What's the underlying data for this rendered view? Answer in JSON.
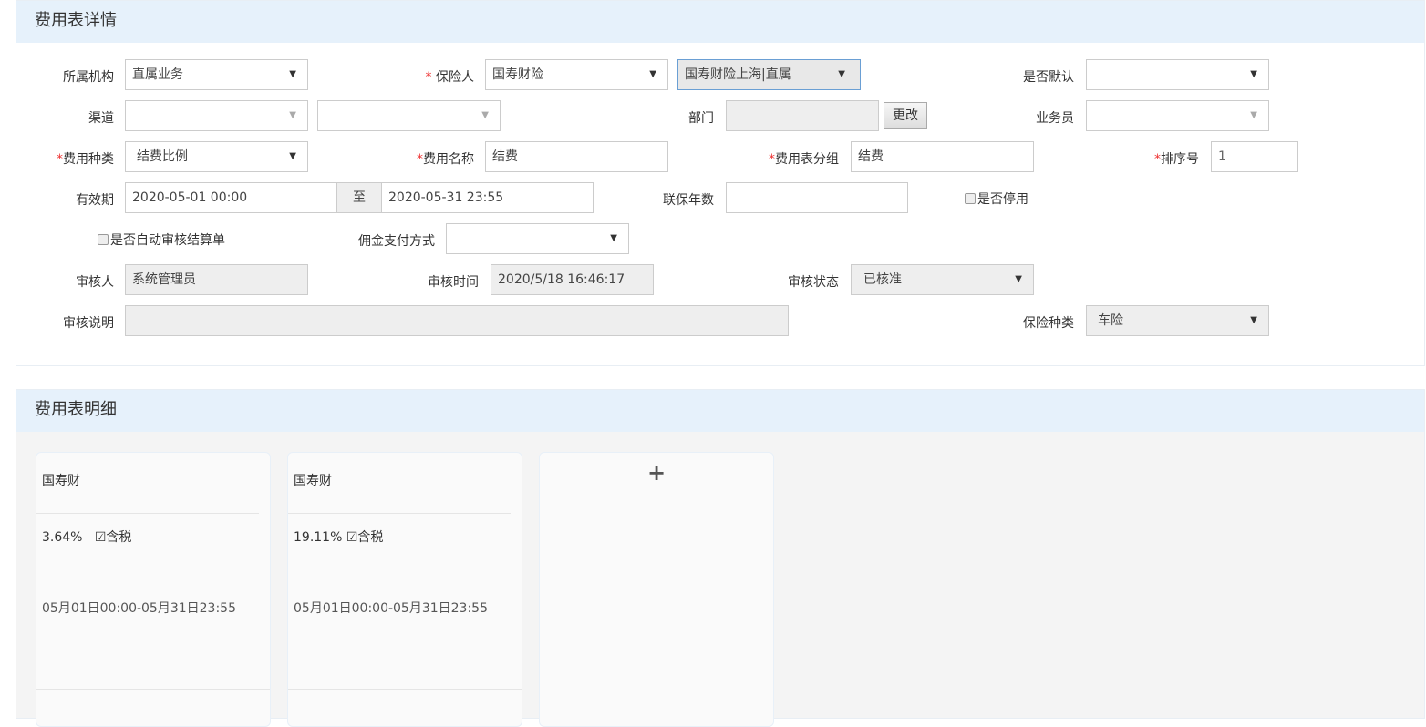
{
  "detail": {
    "title": "费用表详情",
    "org": {
      "label": "所属机构",
      "value": "直属业务"
    },
    "insurer": {
      "label": "保险人",
      "value": "国寿财险",
      "branch": "国寿财险上海|直属"
    },
    "is_default": {
      "label": "是否默认",
      "value": ""
    },
    "channel": {
      "label": "渠道",
      "value1": "",
      "value2": ""
    },
    "dept": {
      "label": "部门",
      "value": "",
      "change_btn": "更改"
    },
    "salesman": {
      "label": "业务员",
      "value": ""
    },
    "fee_type": {
      "label": "费用种类",
      "value": "结费比例"
    },
    "fee_name": {
      "label": "费用名称",
      "value": "结费"
    },
    "group": {
      "label": "费用表分组",
      "value": "结费"
    },
    "sort": {
      "label": "排序号",
      "value": "1"
    },
    "period": {
      "label": "有效期",
      "start": "2020-05-01 00:00",
      "to": "至",
      "end": "2020-05-31 23:55"
    },
    "years": {
      "label": "联保年数",
      "value": ""
    },
    "disabled": {
      "label": "是否停用"
    },
    "auto_audit": {
      "label": "是否自动审核结算单"
    },
    "pay_method": {
      "label": "佣金支付方式",
      "value": ""
    },
    "auditor": {
      "label": "审核人",
      "value": "系统管理员"
    },
    "audit_time": {
      "label": "审核时间",
      "value": "2020/5/18 16:46:17"
    },
    "audit_status": {
      "label": "审核状态",
      "value": "已核准"
    },
    "audit_note": {
      "label": "审核说明",
      "value": ""
    },
    "ins_type": {
      "label": "保险种类",
      "value": "车险"
    }
  },
  "items": {
    "title": "费用表明细",
    "cards": [
      {
        "name": "国寿财",
        "rate": "3.64%",
        "tax": "含税",
        "period": "05月01日00:00-05月31日23:55"
      },
      {
        "name": "国寿财",
        "rate": "19.11%",
        "tax": "含税",
        "period": "05月01日00:00-05月31日23:55"
      }
    ],
    "add": "+"
  }
}
